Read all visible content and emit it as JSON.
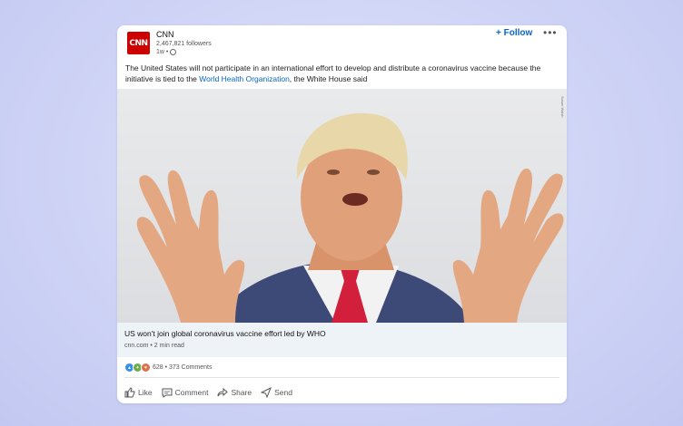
{
  "post": {
    "author": "CNN",
    "followers": "2,467,821 followers",
    "time": "1w •",
    "follow_label": "+ Follow",
    "more_label": "•••",
    "logo_text": "CNN",
    "caption_before": "The United States will not participate in an international effort to develop and distribute a coronavirus vaccine because the initiative is tied to the ",
    "caption_link": "World Health Organization",
    "caption_after": ", the White House said",
    "photo_credit": "Susan Walsh",
    "link": {
      "headline": "US won't join global coronavirus vaccine effort led by WHO",
      "source": "cnn.com • 2 min read"
    },
    "social": {
      "counts": "628 • 373 Comments"
    },
    "actions": {
      "like": "Like",
      "comment": "Comment",
      "share": "Share",
      "send": "Send"
    }
  },
  "colors": {
    "link": "#0a66c2",
    "cnn_red": "#cc0000",
    "like_blue": "#378fe9",
    "celebrate": "#6dae4f",
    "love": "#df704d"
  }
}
